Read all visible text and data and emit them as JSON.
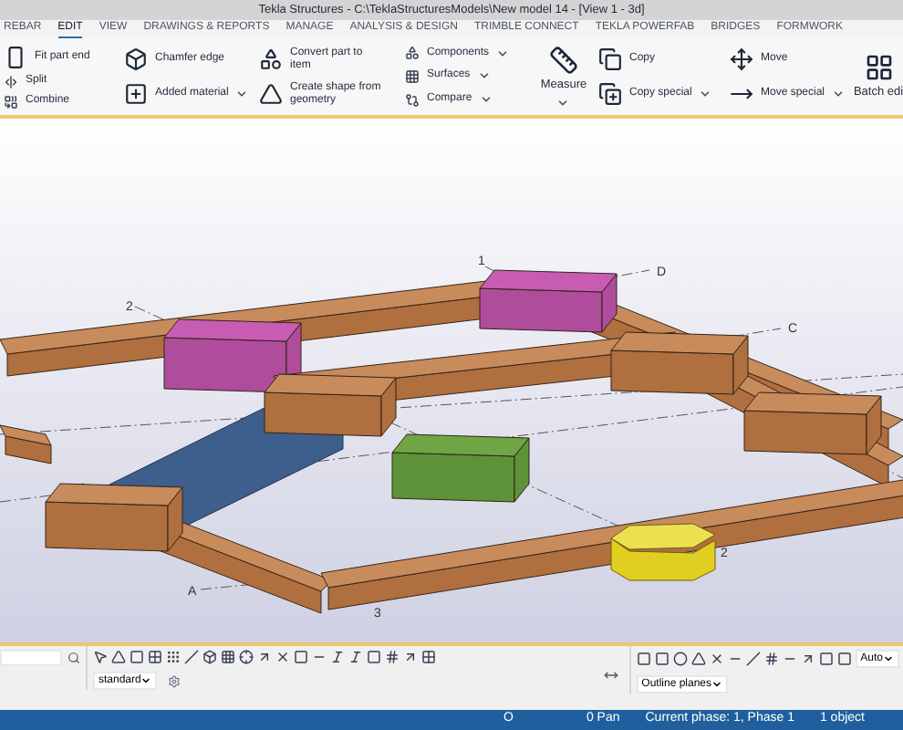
{
  "window": {
    "title": "Tekla Structures - C:\\TeklaStructuresModels\\New model 14  - [View 1 - 3d]"
  },
  "tabs": [
    {
      "label": "REBAR",
      "selected": false
    },
    {
      "label": "EDIT",
      "selected": true
    },
    {
      "label": "VIEW",
      "selected": false
    },
    {
      "label": "DRAWINGS & REPORTS",
      "selected": false
    },
    {
      "label": "MANAGE",
      "selected": false
    },
    {
      "label": "ANALYSIS & DESIGN",
      "selected": false
    },
    {
      "label": "TRIMBLE CONNECT",
      "selected": false
    },
    {
      "label": "TEKLA POWERFAB",
      "selected": false
    },
    {
      "label": "BRIDGES",
      "selected": false
    },
    {
      "label": "FORMWORK",
      "selected": false
    }
  ],
  "ribbon": [
    {
      "kind": "rows",
      "items": [
        {
          "label": "Fit part end",
          "kind": "large",
          "dropdown": false
        },
        {
          "label": "Split",
          "kind": "small",
          "dropdown": false
        },
        {
          "label": "Combine",
          "kind": "small",
          "dropdown": false
        }
      ]
    },
    {
      "kind": "rows",
      "items": [
        {
          "label": "Chamfer edge",
          "kind": "large",
          "dropdown": false
        },
        {
          "label": "Added material",
          "kind": "large",
          "dropdown": true
        }
      ]
    },
    {
      "kind": "rows",
      "items": [
        {
          "label": "Convert part to item",
          "kind": "large",
          "dropdown": false
        },
        {
          "label": "Create shape from geometry",
          "kind": "large",
          "dropdown": false
        }
      ]
    },
    {
      "kind": "rows",
      "items": [
        {
          "label": "Components",
          "kind": "small",
          "dropdown": true
        },
        {
          "label": "Surfaces",
          "kind": "small",
          "dropdown": true
        },
        {
          "label": "Compare",
          "kind": "small",
          "dropdown": true
        }
      ]
    },
    {
      "kind": "tall",
      "items": [
        {
          "label": "Measure",
          "dropdown": true
        }
      ]
    },
    {
      "kind": "rows",
      "items": [
        {
          "label": "Copy",
          "kind": "large",
          "dropdown": false
        },
        {
          "label": "Copy special",
          "kind": "large",
          "dropdown": true
        }
      ]
    },
    {
      "kind": "rows",
      "items": [
        {
          "label": "Move",
          "kind": "large",
          "dropdown": false
        },
        {
          "label": "Move special",
          "kind": "large",
          "dropdown": true
        }
      ]
    },
    {
      "kind": "tall",
      "items": [
        {
          "label": "Batch edi",
          "dropdown": false
        }
      ]
    }
  ],
  "grid_labels": [
    "1",
    "D",
    "2",
    "C",
    "A",
    "3",
    "2"
  ],
  "toolbar": {
    "selects": [
      {
        "label": "standard"
      },
      {
        "label": "Outline planes"
      },
      {
        "label": "Auto"
      }
    ]
  },
  "status_bar": [
    "O",
    "0 Pan",
    "Current phase: 1, Phase 1",
    "1 object"
  ]
}
